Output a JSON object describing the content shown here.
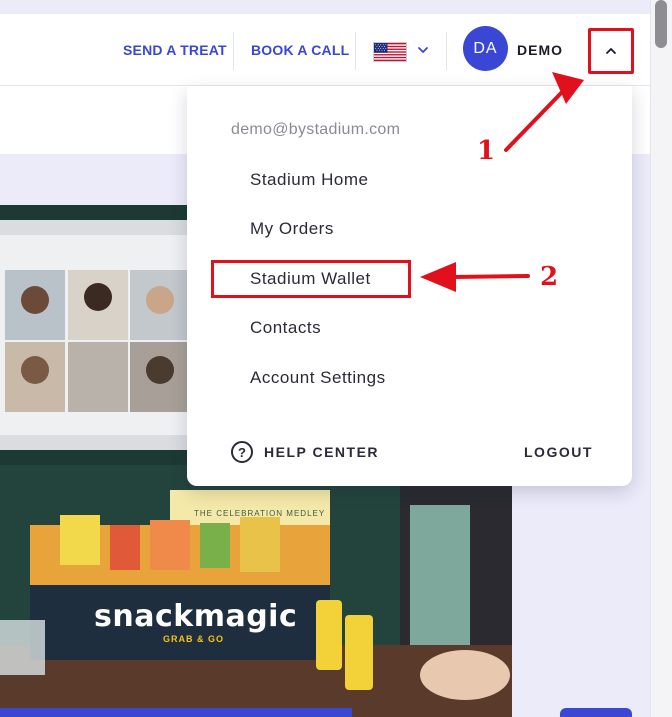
{
  "header": {
    "send_treat": "SEND A TREAT",
    "book_call": "BOOK A CALL",
    "locale_flag": "us-flag-icon",
    "avatar_initials": "DA",
    "user_name": "DEMO",
    "toggle_icon": "chevron-up-icon"
  },
  "dropdown": {
    "email": "demo@bystadium.com",
    "items": [
      {
        "label": "Stadium Home"
      },
      {
        "label": "My Orders"
      },
      {
        "label": "Stadium Wallet"
      },
      {
        "label": "Contacts"
      },
      {
        "label": "Account Settings"
      }
    ],
    "help_icon_glyph": "?",
    "help_label": "HELP CENTER",
    "logout_label": "LOGOUT"
  },
  "hero": {
    "brand": "snackmagic",
    "sub": "GRAB & GO",
    "box_title": "THE CELEBRATION MEDLEY"
  },
  "annotations": {
    "step1": "1",
    "step2": "2"
  },
  "colors": {
    "accent": "#3a47d5",
    "annotation_red": "#e0101c",
    "page_bg": "#ebebfa"
  }
}
